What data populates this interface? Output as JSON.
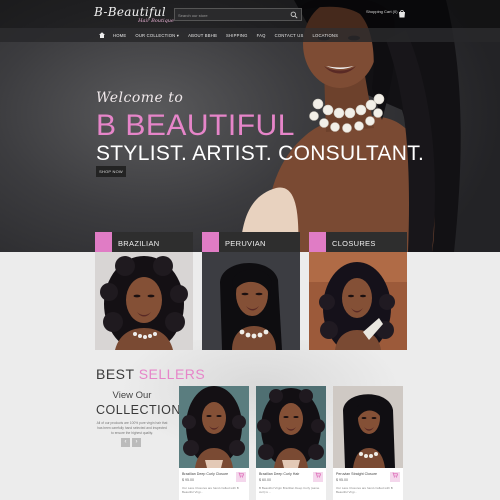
{
  "header": {
    "logo_main": "B-Beautiful",
    "logo_sub": "Hair Boutique",
    "search_placeholder": "Search our store",
    "bag_label": "Shopping Cart (0)"
  },
  "nav": {
    "items": [
      "HOME",
      "OUR COLLECTION ▾",
      "ABOUT BBHB",
      "SHIPPING",
      "FAQ",
      "CONTACT US",
      "LOCATIONS"
    ]
  },
  "hero": {
    "welcome": "Welcome to",
    "brand": "B BEAUTIFUL",
    "tagline": "STYLIST. ARTIST. CONSULTANT.",
    "shop_button": "SHOP NOW"
  },
  "categories": [
    {
      "label": "BRAZILIAN"
    },
    {
      "label": "PERUVIAN"
    },
    {
      "label": "CLOSURES"
    }
  ],
  "best_sellers": {
    "title_a": "BEST ",
    "title_b": "SELLERS",
    "view_our": "View Our",
    "collection": "COLLECTION",
    "description": "All of our products are 100% pure virgin hair that has been carefully hand selected and inspected to ensure the highest quality.",
    "prev": "‹",
    "next": "›"
  },
  "products": [
    {
      "name": "Brazilian Deep Curly Closure",
      "price": "$ 95.00",
      "desc": "Our Lace Closures are hand crafted with B Beautiful Virgi..."
    },
    {
      "name": "Brazilian Deep Curly Hair",
      "price": "$ 60.00",
      "desc": "B Beautiful Virgin Brazilian Deep Curly (same curl) is ..."
    },
    {
      "name": "Peruvian Straight Closure",
      "price": "$ 95.00",
      "desc": "Our Lace Closures are hand crafted with B Beautiful Virgi..."
    }
  ],
  "colors": {
    "accent_pink": "#e685c9",
    "dark_bar": "#2e2e2e"
  }
}
